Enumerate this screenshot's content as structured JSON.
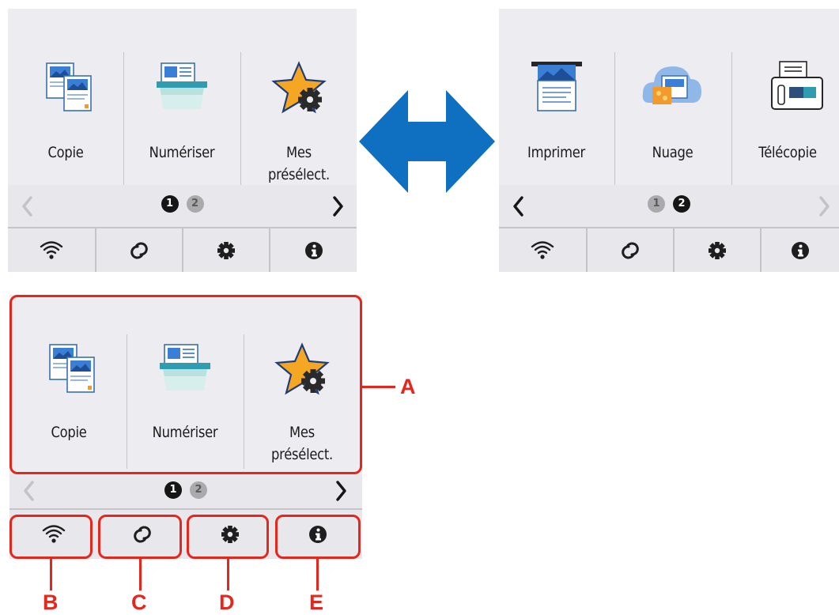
{
  "screens": {
    "page1": {
      "tiles": [
        {
          "label": "Copie",
          "icon": "copy-icon"
        },
        {
          "label": "Numériser",
          "icon": "scan-icon"
        },
        {
          "label_line1": "Mes",
          "label_line2": "présélect.",
          "icon": "star-gear-icon"
        }
      ],
      "pager": {
        "page1": "1",
        "page2": "2"
      }
    },
    "page2": {
      "tiles": [
        {
          "label": "Imprimer",
          "icon": "print-icon"
        },
        {
          "label": "Nuage",
          "icon": "cloud-icon"
        },
        {
          "label": "Télécopie",
          "icon": "fax-icon"
        }
      ],
      "pager": {
        "page1": "1",
        "page2": "2"
      }
    }
  },
  "bottom_bar": [
    "wifi-icon",
    "wireless-connect-icon",
    "settings-gear-icon",
    "info-icon"
  ],
  "callouts": {
    "a": "A",
    "b": "B",
    "c": "C",
    "d": "D",
    "e": "E"
  },
  "colors": {
    "callout": "#e5261c",
    "swap_arrow": "#0f6fc0"
  }
}
